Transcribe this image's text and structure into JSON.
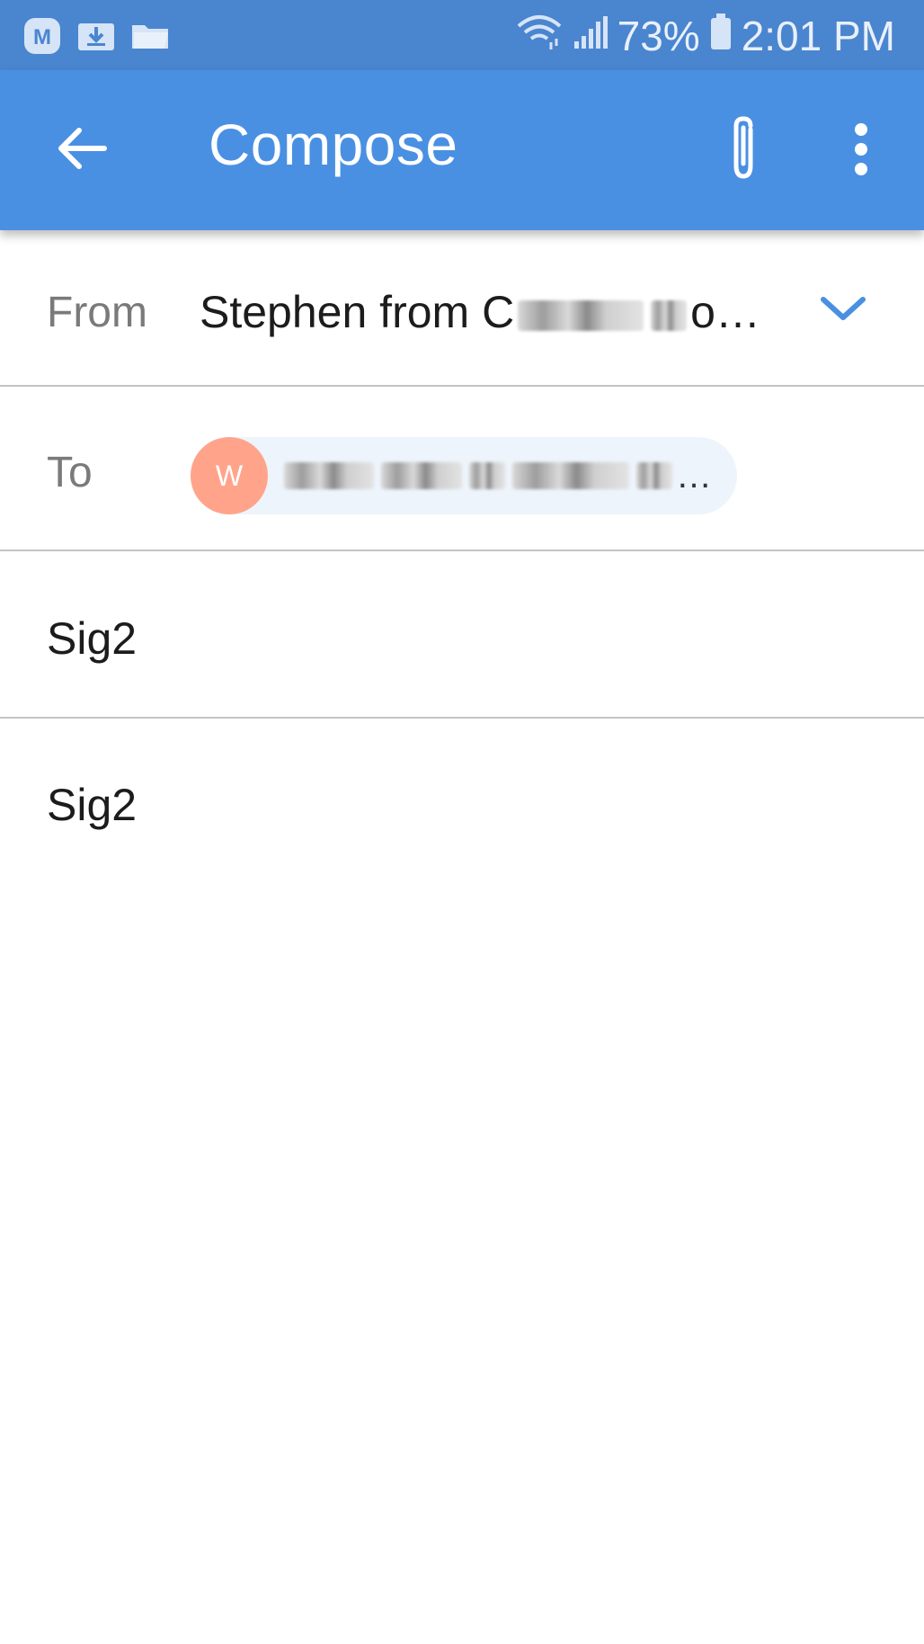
{
  "status_bar": {
    "left_icons": [
      "m-app-icon",
      "download-icon",
      "folder-icon"
    ],
    "battery": "73%",
    "time": "2:01 PM"
  },
  "app_bar": {
    "title": "Compose",
    "color": "#4a90e2"
  },
  "from": {
    "label": "From",
    "value": "Stephen from C",
    "value_tail": "o…"
  },
  "to": {
    "label": "To",
    "recipient_initial": "W",
    "recipient_tail": "…"
  },
  "subject": {
    "value": "Sig2"
  },
  "body": {
    "text": "Sig2"
  },
  "colors": {
    "status_bar": "#4a85cf",
    "app_bar": "#4a90e2",
    "avatar": "#ffa48b",
    "chevron": "#4a90e2",
    "divider": "#c4c4c4"
  }
}
